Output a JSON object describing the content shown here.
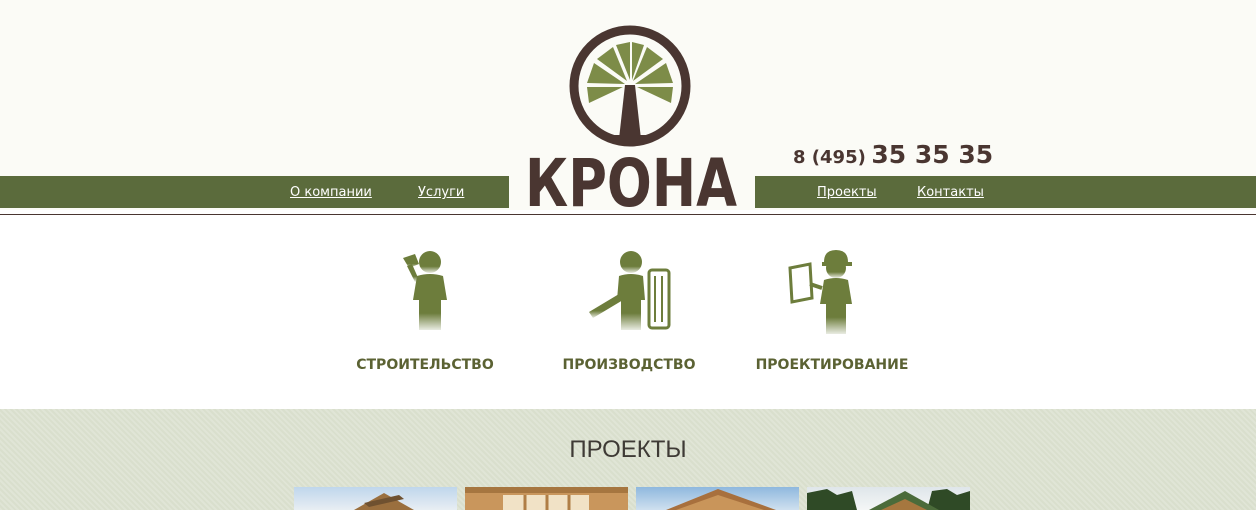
{
  "brand": {
    "name": "КРОНА",
    "colors": {
      "primary": "#5b6b3c",
      "brown": "#4a3631",
      "olive": "#7d8c48",
      "header_bg": "#fbfbf6",
      "projects_bg": "#d9dfcd"
    }
  },
  "contact": {
    "phone_code": "8 (495)",
    "phone_number": "35 35 35"
  },
  "nav": {
    "left": [
      {
        "label": "О компании"
      },
      {
        "label": "Услуги"
      }
    ],
    "right": [
      {
        "label": "Проекты"
      },
      {
        "label": "Контакты"
      }
    ]
  },
  "services": [
    {
      "label": "СТРОИТЕЛЬСТВО",
      "icon": "builder-hammer-icon"
    },
    {
      "label": "ПРОИЗВОДСТВО",
      "icon": "worker-saw-icon"
    },
    {
      "label": "ПРОЕКТИРОВАНИЕ",
      "icon": "engineer-plan-icon"
    }
  ],
  "projects": {
    "title": "ПРОЕКТЫ",
    "thumbnails": [
      {
        "icon": "project-photo-1"
      },
      {
        "icon": "project-photo-2"
      },
      {
        "icon": "project-photo-3"
      },
      {
        "icon": "project-photo-4"
      }
    ]
  }
}
